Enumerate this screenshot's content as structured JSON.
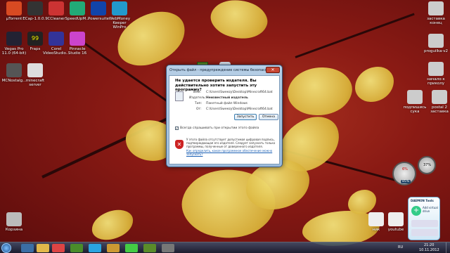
{
  "desktop_icons": [
    {
      "label": "µTorrent",
      "color": "#d84a22"
    },
    {
      "label": "ECap-1.0.0.9",
      "color": "#333"
    },
    {
      "label": "CCleaner",
      "color": "#c33"
    },
    {
      "label": "SpeedUpM...",
      "color": "#2a7"
    },
    {
      "label": "Powersuite",
      "color": "#14a"
    },
    {
      "label": "WebMoney Keeper WinPro",
      "color": "#29c"
    },
    {
      "label": "Vegas Pro 11.0 (64-bit)",
      "color": "#223"
    },
    {
      "label": "Fraps",
      "color": "#ff0"
    },
    {
      "label": "Corel VideoStudio...",
      "color": "#339"
    },
    {
      "label": "Pinnacle Studio 16",
      "color": "#c4c"
    },
    {
      "label": "MCNostalg...",
      "color": "#555"
    },
    {
      "label": "minecraft server",
      "color": "#ddd"
    },
    {
      "label": "Корзина",
      "color": "#bbb"
    }
  ],
  "right_icons": [
    "заставка конец",
    "proguilka-v2",
    "начало к приколу",
    "подпишись сука",
    "postal 2 заставка"
  ],
  "bottom_icons": [
    "ник",
    "youtube"
  ],
  "dialog": {
    "title": "Открыть файл - предупреждение системы безопасности",
    "question": "Не удается проверить издателя. Вы действительно хотите запустить эту программу?",
    "name_label": "Имя:",
    "name_value": "C:\\Users\\Sweezy\\Desktop\\Minecraft64.bat",
    "publisher_label": "Издатель:",
    "publisher_value": "Неизвестный издатель",
    "type_label": "Тип:",
    "type_value": "Пакетный файл Windows",
    "from_label": "От:",
    "from_value": "C:\\Users\\Sweezy\\Desktop\\Minecraft64.bat",
    "run_button": "Запустить",
    "cancel_button": "Отмена",
    "checkbox_label": "Всегда спрашивать при открытии этого файла",
    "warning_text": "У этого файла отсутствует допустимая цифровая подпись, подтверждающая его издателя. Следует запускать только программы, полученные от доверенного издателя.",
    "warning_link": "Как определить, какое программное обеспечение можно запускать?"
  },
  "gadget_meter": {
    "cpu": "6%",
    "mem": "37%",
    "drive": "85%"
  },
  "drive_gadget": {
    "title": "DAEMON Tools",
    "label": "Add virtual drive"
  },
  "taskbar": {
    "lang": "RU",
    "time": "21:20",
    "date": "10.11.2012"
  }
}
